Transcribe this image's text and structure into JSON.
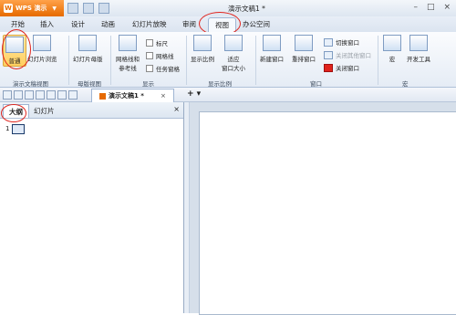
{
  "app": {
    "name": "WPS 演示",
    "window_title": "演示文稿1 *"
  },
  "tabs": [
    "开始",
    "插入",
    "设计",
    "动画",
    "幻灯片放映",
    "审阅",
    "视图",
    "办公空间"
  ],
  "ribbon": {
    "normal": "普通",
    "slide_sorter": "幻灯片浏览",
    "slide_master": "幻灯片母版",
    "grid": "网格线和\n参考线",
    "ruler": "标尺",
    "gridlines": "网格线",
    "taskpane": "任务窗格",
    "zoom": "显示比例",
    "fit": "适应\n窗口大小",
    "new_window": "新建窗口",
    "arrange": "重排窗口",
    "switch_window": "切换窗口",
    "close_others": "关闭其他窗口",
    "close_window": "关闭窗口",
    "macro": "宏",
    "dev_tools": "开发工具",
    "groups": {
      "doc_views": "演示文稿视图",
      "master_views": "母版视图",
      "show": "显示",
      "zoom": "显示比例",
      "window": "窗口",
      "macro": "宏"
    }
  },
  "doc_tab": {
    "name": "演示文稿1 *",
    "close": "×"
  },
  "left_pane": {
    "tabs": [
      "大纲",
      "幻灯片"
    ],
    "close": "×",
    "slide_number": "1"
  },
  "colors": {
    "accent": "#e66a00",
    "highlight": "#e0231c"
  }
}
